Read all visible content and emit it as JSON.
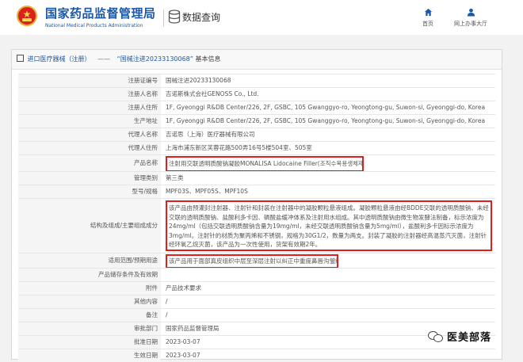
{
  "header": {
    "site_title_cn": "国家药品监督管理局",
    "site_title_en": "National Medical Products Administration",
    "section_title": "数据查询",
    "nav": {
      "home_label": "首页",
      "service_label": "网上办事大厅"
    }
  },
  "breadcrumb": {
    "category": "进口医疗器械（注册）",
    "separator": "——",
    "record": "“国械注进20233130068”",
    "suffix": "基本信息"
  },
  "record": {
    "rows": [
      {
        "label": "注册证编号",
        "value": "国械注进20233130068"
      },
      {
        "label": "注册人名称",
        "value": "吉诺斯株式会社GENOSS Co., Ltd."
      },
      {
        "label": "注册人住所",
        "value": "1F, Gyeonggi R&DB Center/226, 2F, GSBC, 105 Gwanggyo-ro, Yeongtong-gu, Suwon-si, Gyeonggi-do, Korea"
      },
      {
        "label": "生产地址",
        "value": "1F, Gyeonggi R&DB Center/226, 2F, GSBC, 105 Gwanggyo-ro, Yeongtong-gu, Suwon-si, Gyeonggi-do, Korea"
      },
      {
        "label": "代理人名称",
        "value": "吉诺思（上海）医疗器械有限公司"
      },
      {
        "label": "代理人住所",
        "value": "上海市浦东新区芙蓉花路500弄16号5楼504室、505室"
      },
      {
        "label": "产品名称",
        "value": "注射用交联透明质酸钠凝胶MONALISA Lidocaine Filler(조직수복용생체재료)"
      },
      {
        "label": "管理类别",
        "value": "第三类"
      },
      {
        "label": "型号/规格",
        "value": "MPF03S、MPF05S、MPF10S"
      },
      {
        "label": "结构及组成/主要组成成分",
        "value": "该产品由预灌封注射器、注射针和封装在注射器中的凝胶颗粒悬液组成。凝胶颗粒悬液由经BDDE交联的透明质酸钠、未经交联的透明质酸钠、盐酸利多卡因、磷酸盐缓冲体系及注射用水组成。其中透明质酸钠由微生物发酵法制备，标示浓度为24mg/ml（包括交联透明质酸钠含量为19mg/ml，未经交联透明质酸钠含量为5mg/ml），盐酸利多卡因标示浓度为3mg/ml。注射针的材质为聚丙烯和不锈钢，规格为30G1/2，数量为两支。封装了凝胶的注射器经高温蒸汽灭菌，注射针经环氧乙烷灭菌，该产品为一次性使用，货架有效期2年。"
      },
      {
        "label": "适用范围/预期用途",
        "value": "该产品用于面部真皮组织中层至深层注射以纠正中重度鼻唇沟皱纹。"
      },
      {
        "label": "产品储存条件及有效期",
        "value": ""
      },
      {
        "label": "附件",
        "value": "产品技术要求"
      },
      {
        "label": "其他内容",
        "value": "/"
      },
      {
        "label": "备注",
        "value": "/"
      },
      {
        "label": "审批部门",
        "value": "国家药品监督管理局"
      },
      {
        "label": "批准日期",
        "value": "2023-03-07"
      },
      {
        "label": "生效日期",
        "value": "2023-03-07"
      }
    ]
  },
  "watermark": {
    "text": "医美部落"
  },
  "colors": {
    "brand_blue": "#1b58a8",
    "highlight_red": "#e02020"
  }
}
